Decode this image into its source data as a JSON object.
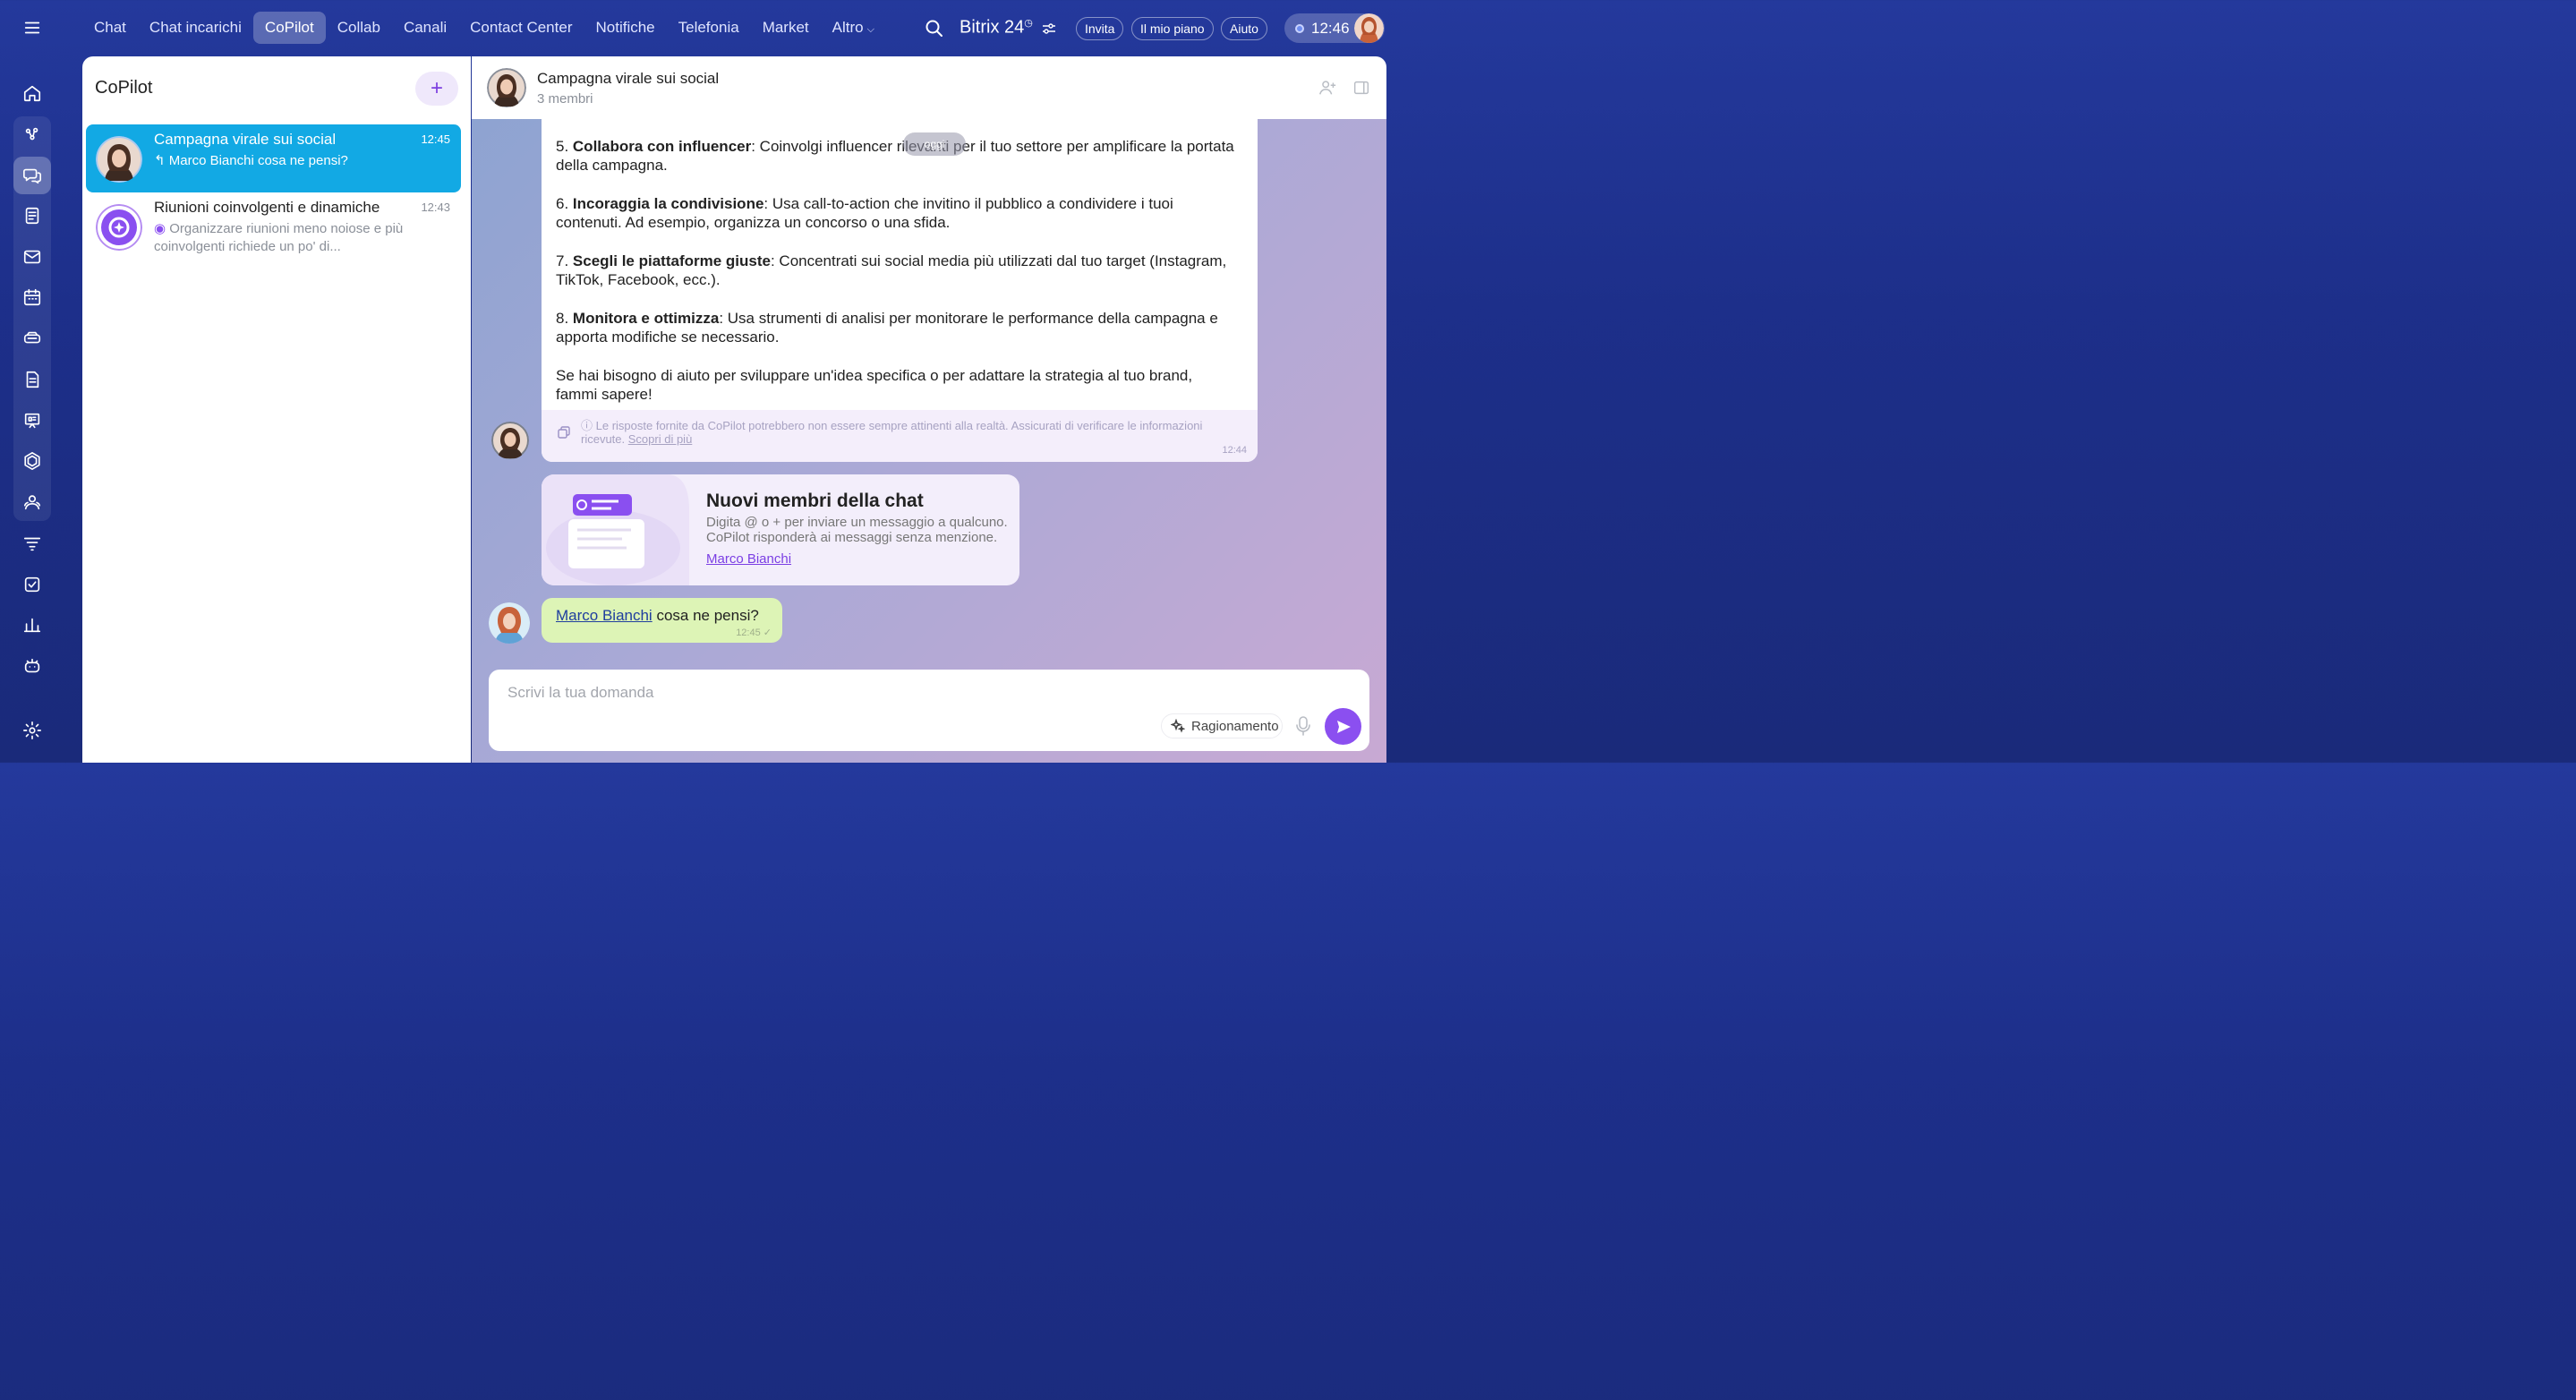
{
  "top_nav": {
    "items": [
      {
        "label": "Chat"
      },
      {
        "label": "Chat incarichi"
      },
      {
        "label": "CoPilot"
      },
      {
        "label": "Collab"
      },
      {
        "label": "Canali"
      },
      {
        "label": "Contact Center"
      },
      {
        "label": "Notifiche"
      },
      {
        "label": "Telefonia"
      },
      {
        "label": "Market"
      },
      {
        "label": "Altro"
      }
    ],
    "active": "CoPilot"
  },
  "header_right": {
    "brand": "Bitrix 24",
    "invite_label": "Invita",
    "plan_label": "Il mio piano",
    "help_label": "Aiuto",
    "clock": "12:46"
  },
  "left_panel": {
    "title": "CoPilot",
    "chats": [
      {
        "title": "Campagna virale sui social",
        "time": "12:45",
        "preview": "Marco Bianchi cosa ne pensi?",
        "active": true
      },
      {
        "title": "Riunioni coinvolgenti e dinamiche",
        "time": "12:43",
        "preview": "Organizzare riunioni meno noiose e più coinvolgenti richiede un po' di...",
        "active": false
      }
    ]
  },
  "chat": {
    "title": "Campagna virale sui social",
    "members": "3 membri",
    "date_badge": "oggi",
    "ai_message": {
      "items": [
        {
          "num": "5. ",
          "bold": "Collabora con influencer",
          "text": ": Coinvolgi influencer rilevanti per il tuo settore per amplificare la portata della campagna."
        },
        {
          "num": "6. ",
          "bold": "Incoraggia la condivisione",
          "text": ": Usa call-to-action che invitino il pubblico a condividere i tuoi contenuti. Ad esempio, organizza un concorso o una sfida."
        },
        {
          "num": "7. ",
          "bold": "Scegli le piattaforme giuste",
          "text": ": Concentrati sui social media più utilizzati dal tuo target (Instagram, TikTok, Facebook, ecc.)."
        },
        {
          "num": "8. ",
          "bold": "Monitora e ottimizza",
          "text": ": Usa strumenti di analisi per monitorare le performance della campagna e apporta modifiche se necessario."
        }
      ],
      "closing": "Se hai bisogno di aiuto per sviluppare un'idea specifica o per adattare la strategia al tuo brand, fammi sapere!",
      "disclaimer": "Le risposte fornite da CoPilot potrebbero non essere sempre attinenti alla realtà. Assicurati di verificare le informazioni ricevute.",
      "disclaimer_link": "Scopri di più",
      "time": "12:44"
    },
    "system_card": {
      "title": "Nuovi membri della chat",
      "desc": "Digita @ o + per inviare un messaggio a qualcuno. CoPilot risponderà ai messaggi senza menzione.",
      "link": "Marco Bianchi"
    },
    "my_message": {
      "mention": "Marco Bianchi",
      "text": " cosa ne pensi?",
      "time": "12:45"
    },
    "composer": {
      "placeholder": "Scrivi la tua domanda",
      "reasoning_label": "Ragionamento"
    }
  },
  "colors": {
    "accent": "#12a9e4",
    "send": "#8b4ff0",
    "my_bubble": "#ddf4b6"
  }
}
